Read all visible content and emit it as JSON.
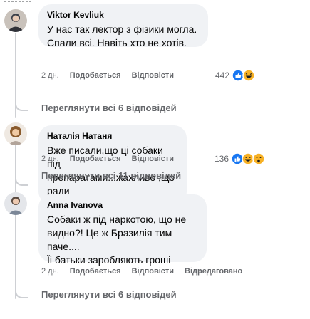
{
  "comments": [
    {
      "author": "Viktor Kevliuk",
      "text": "У нас так лектор з фізики могла.\nСпали всі. Навіть хто не хотів.",
      "time": "2 дн.",
      "like": "Подобається",
      "reply": "Відповісти",
      "reaction_count": "442",
      "reaction_icons": [
        "like-icon",
        "haha-icon"
      ],
      "more_replies": "Переглянути всі 6 відповідей"
    },
    {
      "author": "Наталія Натаня",
      "text": "Вже писали,що ці собаки під\nпрепаратами...жахливо ,що ради\nлайків йдуть на все",
      "time": "2 дн.",
      "like": "Подобається",
      "reply": "Відповісти",
      "reaction_count": "136",
      "reaction_icons": [
        "like-icon",
        "haha-icon",
        "wow-icon"
      ],
      "more_replies": "Переглянути всі 11 відповідей"
    },
    {
      "author": "Anna Ivanova",
      "text": "Собаки ж під наркотою, що не\nвидно?! Це ж Бразилія тим паче....\nЇі батьки заробляють гроші",
      "time": "2 дн.",
      "like": "Подобається",
      "reply": "Відповісти",
      "edited": "Відредаговано",
      "more_replies": "Переглянути всі 6 відповідей"
    }
  ],
  "colors": {
    "bubble": "#f0f2f5",
    "secondary_text": "#65676b",
    "like_blue": "#1877f2",
    "reaction_yellow": "#f7b125"
  }
}
